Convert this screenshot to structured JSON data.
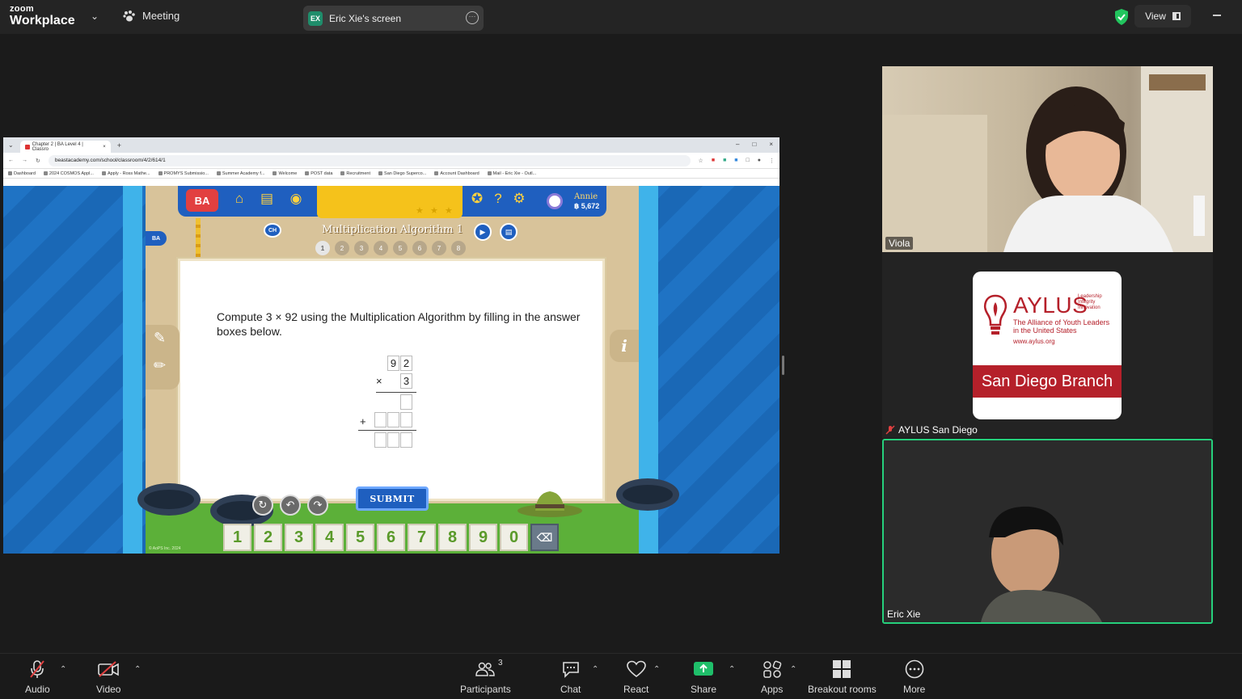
{
  "window": {
    "brand_top": "zoom",
    "brand_bottom": "Workplace",
    "meeting_label": "Meeting",
    "share_badge": "EX",
    "share_title": "Eric Xie's screen",
    "view_label": "View"
  },
  "browser": {
    "tab_title": "Chapter 2 | BA Level 4 | Classro",
    "url": "beastacademy.com/school/classroom/4/2/614/1",
    "bookmarks": [
      "Dashboard",
      "2024 COSMOS Appl...",
      "Apply - Ross Mathe...",
      "PROMYS Submissio...",
      "Summer Academy f...",
      "Welcome",
      "POST data",
      "Recruitment",
      "San Diego Superco...",
      "Account Dashboard",
      "Mail - Eric Xie - Outl..."
    ]
  },
  "game": {
    "logo": "BA",
    "user_name": "Annie",
    "user_coins": "฿ 5,672",
    "chapter_badge": "CH",
    "side_badge": "BA",
    "lesson_title": "Multiplication Algorithm 1",
    "progress_dots": [
      "1",
      "2",
      "3",
      "4",
      "5",
      "6",
      "7",
      "8"
    ],
    "question": "Compute 3 × 92 using the Multiplication Algorithm by filling in the answer boxes below.",
    "multiplicand": [
      "9",
      "2"
    ],
    "multiplier": "3",
    "times_sign": "×",
    "plus_sign": "+",
    "submit_label": "SUBMIT",
    "keys": [
      "1",
      "2",
      "3",
      "4",
      "5",
      "6",
      "7",
      "8",
      "9",
      "0"
    ],
    "delete_key": "⌫",
    "copyright": "© AoPS Inc. 2024"
  },
  "participants": [
    {
      "name": "Viola"
    },
    {
      "name": "AYLUS San Diego"
    },
    {
      "name": "Eric Xie"
    }
  ],
  "aylus_logo": {
    "name": "AYLUS",
    "tagline": [
      "Leadership",
      "Integrity",
      "Innovation"
    ],
    "subtitle_1": "The Alliance of Youth Leaders",
    "subtitle_2": "in the United States",
    "url": "www.aylus.org",
    "branch": "San Diego Branch"
  },
  "toolbar": {
    "audio": "Audio",
    "video": "Video",
    "participants": "Participants",
    "participants_count": "3",
    "chat": "Chat",
    "react": "React",
    "share": "Share",
    "apps": "Apps",
    "breakout": "Breakout rooms",
    "more": "More"
  },
  "colors": {
    "accent_green": "#26d07c",
    "share_green": "#1fbf6a",
    "aylus_red": "#b5202a",
    "game_blue": "#1f5fbf"
  }
}
